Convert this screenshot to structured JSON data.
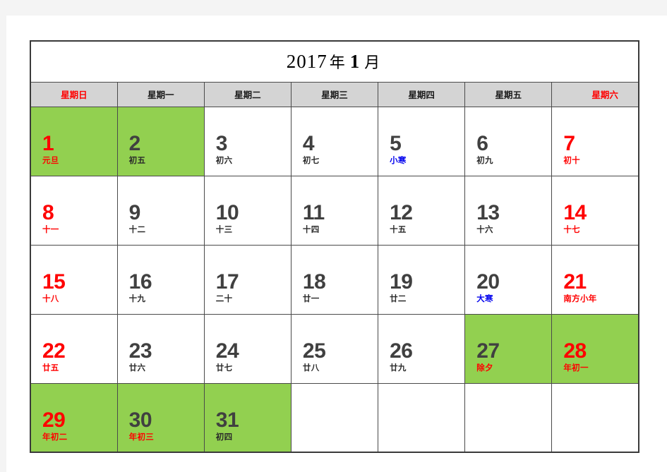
{
  "title": {
    "year": "2017",
    "year_suffix": "年",
    "month": "1",
    "month_suffix": "月",
    "full": "2017 年 1 月"
  },
  "weekdays": [
    {
      "label": "星期日",
      "type": "weekend"
    },
    {
      "label": "星期一",
      "type": "weekday"
    },
    {
      "label": "星期二",
      "type": "weekday"
    },
    {
      "label": "星期三",
      "type": "weekday"
    },
    {
      "label": "星期四",
      "type": "weekday"
    },
    {
      "label": "星期五",
      "type": "weekday"
    },
    {
      "label": "星期六",
      "type": "weekend"
    }
  ],
  "colors": {
    "holiday_green": "#92D050",
    "header_gray": "#D4D4D4",
    "weekend_red": "#FF0000",
    "solar_term_blue": "#0000EE",
    "day_num_dark": "#404040",
    "page_gray": "#F4F4F4"
  },
  "weeks": [
    [
      {
        "num": "1",
        "lunar": "元旦",
        "num_color": "red",
        "lunar_color": "red",
        "highlight": true
      },
      {
        "num": "2",
        "lunar": "初五",
        "num_color": "dark",
        "lunar_color": "dark",
        "highlight": true
      },
      {
        "num": "3",
        "lunar": "初六",
        "num_color": "dark",
        "lunar_color": "dark",
        "highlight": false
      },
      {
        "num": "4",
        "lunar": "初七",
        "num_color": "dark",
        "lunar_color": "dark",
        "highlight": false
      },
      {
        "num": "5",
        "lunar": "小寒",
        "num_color": "dark",
        "lunar_color": "blue",
        "highlight": false
      },
      {
        "num": "6",
        "lunar": "初九",
        "num_color": "dark",
        "lunar_color": "dark",
        "highlight": false
      },
      {
        "num": "7",
        "lunar": "初十",
        "num_color": "red",
        "lunar_color": "red",
        "highlight": false
      }
    ],
    [
      {
        "num": "8",
        "lunar": "十一",
        "num_color": "red",
        "lunar_color": "red",
        "highlight": false
      },
      {
        "num": "9",
        "lunar": "十二",
        "num_color": "dark",
        "lunar_color": "dark",
        "highlight": false
      },
      {
        "num": "10",
        "lunar": "十三",
        "num_color": "dark",
        "lunar_color": "dark",
        "highlight": false
      },
      {
        "num": "11",
        "lunar": "十四",
        "num_color": "dark",
        "lunar_color": "dark",
        "highlight": false
      },
      {
        "num": "12",
        "lunar": "十五",
        "num_color": "dark",
        "lunar_color": "dark",
        "highlight": false
      },
      {
        "num": "13",
        "lunar": "十六",
        "num_color": "dark",
        "lunar_color": "dark",
        "highlight": false
      },
      {
        "num": "14",
        "lunar": "十七",
        "num_color": "red",
        "lunar_color": "red",
        "highlight": false
      }
    ],
    [
      {
        "num": "15",
        "lunar": "十八",
        "num_color": "red",
        "lunar_color": "red",
        "highlight": false
      },
      {
        "num": "16",
        "lunar": "十九",
        "num_color": "dark",
        "lunar_color": "dark",
        "highlight": false
      },
      {
        "num": "17",
        "lunar": "二十",
        "num_color": "dark",
        "lunar_color": "dark",
        "highlight": false
      },
      {
        "num": "18",
        "lunar": "廿一",
        "num_color": "dark",
        "lunar_color": "dark",
        "highlight": false
      },
      {
        "num": "19",
        "lunar": "廿二",
        "num_color": "dark",
        "lunar_color": "dark",
        "highlight": false
      },
      {
        "num": "20",
        "lunar": "大寒",
        "num_color": "dark",
        "lunar_color": "blue",
        "highlight": false
      },
      {
        "num": "21",
        "lunar": "南方小年",
        "num_color": "red",
        "lunar_color": "red",
        "highlight": false
      }
    ],
    [
      {
        "num": "22",
        "lunar": "廿五",
        "num_color": "red",
        "lunar_color": "red",
        "highlight": false
      },
      {
        "num": "23",
        "lunar": "廿六",
        "num_color": "dark",
        "lunar_color": "dark",
        "highlight": false
      },
      {
        "num": "24",
        "lunar": "廿七",
        "num_color": "dark",
        "lunar_color": "dark",
        "highlight": false
      },
      {
        "num": "25",
        "lunar": "廿八",
        "num_color": "dark",
        "lunar_color": "dark",
        "highlight": false
      },
      {
        "num": "26",
        "lunar": "廿九",
        "num_color": "dark",
        "lunar_color": "dark",
        "highlight": false
      },
      {
        "num": "27",
        "lunar": "除夕",
        "num_color": "dark",
        "lunar_color": "red",
        "highlight": true
      },
      {
        "num": "28",
        "lunar": "年初一",
        "num_color": "red",
        "lunar_color": "red",
        "highlight": true
      }
    ],
    [
      {
        "num": "29",
        "lunar": "年初二",
        "num_color": "red",
        "lunar_color": "red",
        "highlight": true
      },
      {
        "num": "30",
        "lunar": "年初三",
        "num_color": "dark",
        "lunar_color": "red",
        "highlight": true
      },
      {
        "num": "31",
        "lunar": "初四",
        "num_color": "dark",
        "lunar_color": "dark",
        "highlight": true
      },
      {
        "num": "",
        "lunar": "",
        "num_color": "dark",
        "lunar_color": "dark",
        "highlight": false
      },
      {
        "num": "",
        "lunar": "",
        "num_color": "dark",
        "lunar_color": "dark",
        "highlight": false
      },
      {
        "num": "",
        "lunar": "",
        "num_color": "dark",
        "lunar_color": "dark",
        "highlight": false
      },
      {
        "num": "",
        "lunar": "",
        "num_color": "dark",
        "lunar_color": "dark",
        "highlight": false
      }
    ]
  ]
}
